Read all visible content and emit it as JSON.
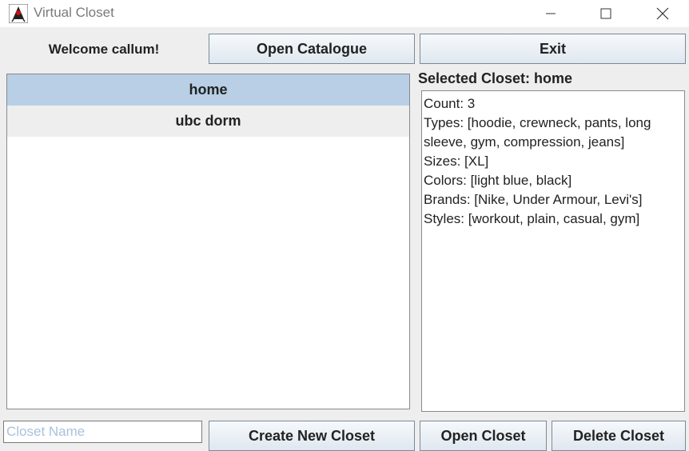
{
  "window": {
    "title": "Virtual Closet"
  },
  "header": {
    "welcome": "Welcome callum!",
    "catalogue_label": "Open Catalogue",
    "exit_label": "Exit"
  },
  "closets": [
    {
      "name": "home",
      "selected": true
    },
    {
      "name": "ubc dorm",
      "selected": false
    }
  ],
  "details": {
    "heading": "Selected Closet: home",
    "lines": [
      "Count: 3",
      "Types: [hoodie, crewneck, pants, long sleeve, gym, compression, jeans]",
      "Sizes: [XL]",
      "Colors: [light blue, black]",
      "Brands: [Nike, Under Armour, Levi's]",
      "Styles: [workout, plain, casual, gym]"
    ]
  },
  "footer": {
    "closet_name_placeholder": "Closet Name",
    "closet_name_value": "",
    "create_label": "Create New Closet",
    "open_label": "Open Closet",
    "delete_label": "Delete Closet"
  },
  "icons": {
    "app": "java-duke-icon",
    "minimize": "minimize-icon",
    "maximize": "maximize-icon",
    "close": "close-icon"
  },
  "colors": {
    "selection": "#b8cfe5",
    "placeholder": "#a9c2dd"
  }
}
